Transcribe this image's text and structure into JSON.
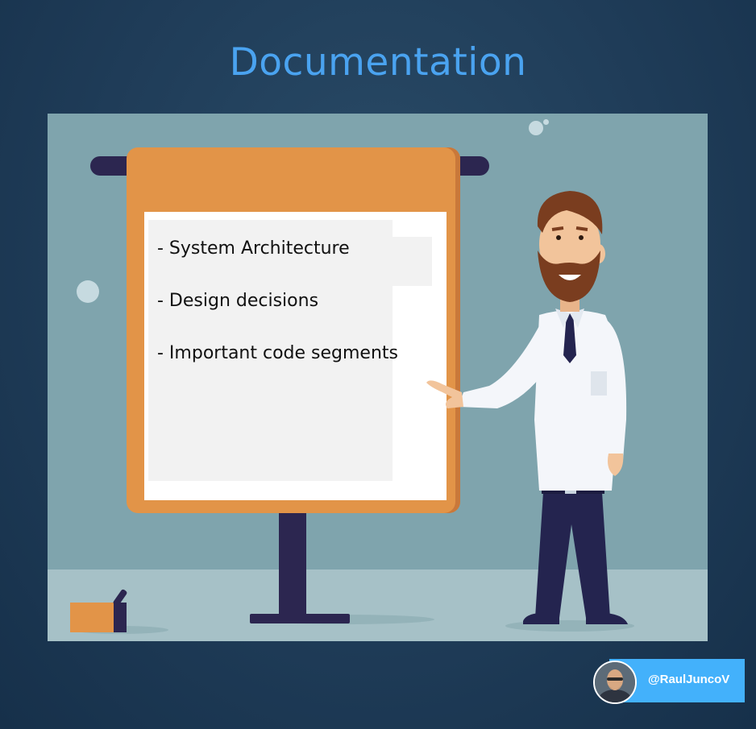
{
  "title": "Documentation",
  "slide": {
    "items": [
      "- System Architecture",
      "- Design decisions",
      "- Important code segments"
    ]
  },
  "badge": {
    "handle": "@RaulJuncoV"
  },
  "colors": {
    "title": "#4aa3f0",
    "background": "#1f3c58",
    "scene": "#7fa4ad",
    "board": "#e29448",
    "badge": "#43b1fb"
  }
}
